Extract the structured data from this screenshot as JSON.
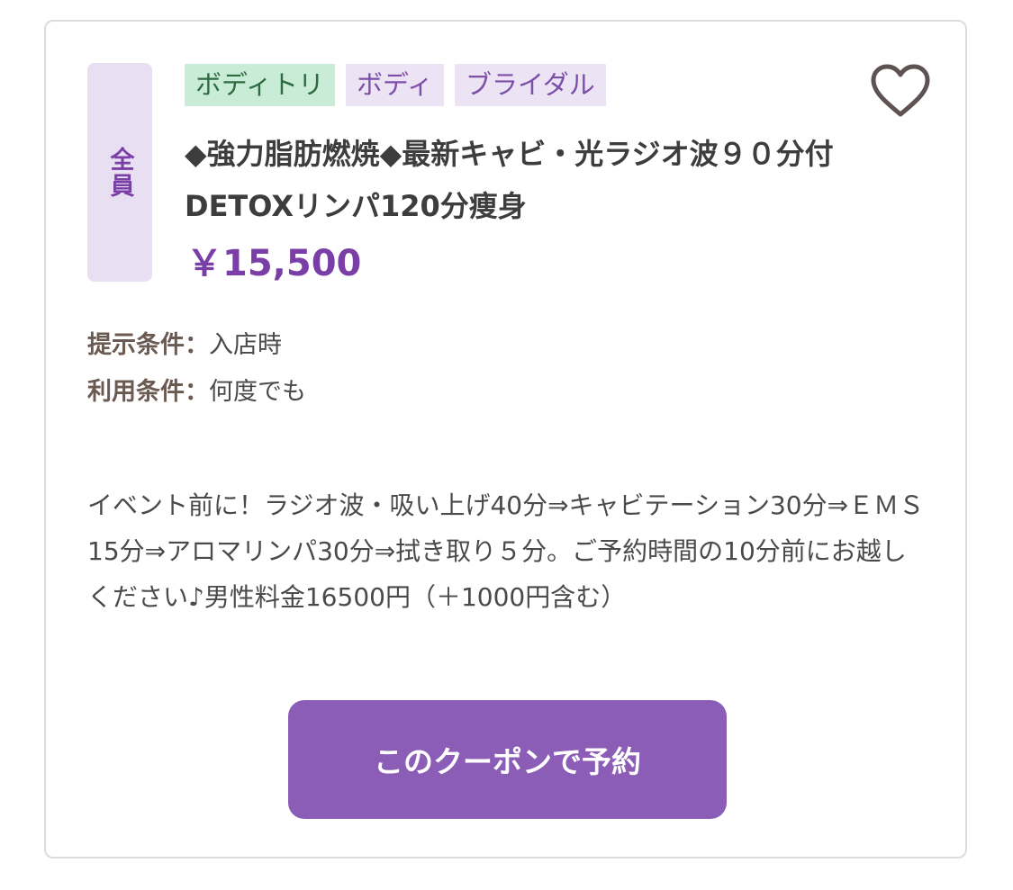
{
  "coupon": {
    "target_label": "全員",
    "tags": [
      {
        "label": "ボディトリ",
        "color": "#c9ecd6"
      },
      {
        "label": "ボディ",
        "color": "#ece3f4"
      },
      {
        "label": "ブライダル",
        "color": "#ece3f4"
      }
    ],
    "favorite_icon": "heart-outline-icon",
    "title": "◆強力脂肪燃焼◆最新キャビ・光ラジオ波９０分付DETOXリンパ120分痩身",
    "price": "￥15,500",
    "conditions": [
      {
        "label": "提示条件：",
        "value": "入店時"
      },
      {
        "label": "利用条件：",
        "value": "何度でも"
      }
    ],
    "description": "イベント前に！ラジオ波・吸い上げ40分⇒キャビテーション30分⇒ＥＭＳ15分⇒アロマリンパ30分⇒拭き取り５分。ご予約時間の10分前にお越しください♪男性料金16500円（＋1000円含む）",
    "reserve_button": "このクーポンで予約"
  },
  "colors": {
    "accent": "#8c5db6",
    "price": "#7a3fa6",
    "border": "#dcdcdc"
  }
}
